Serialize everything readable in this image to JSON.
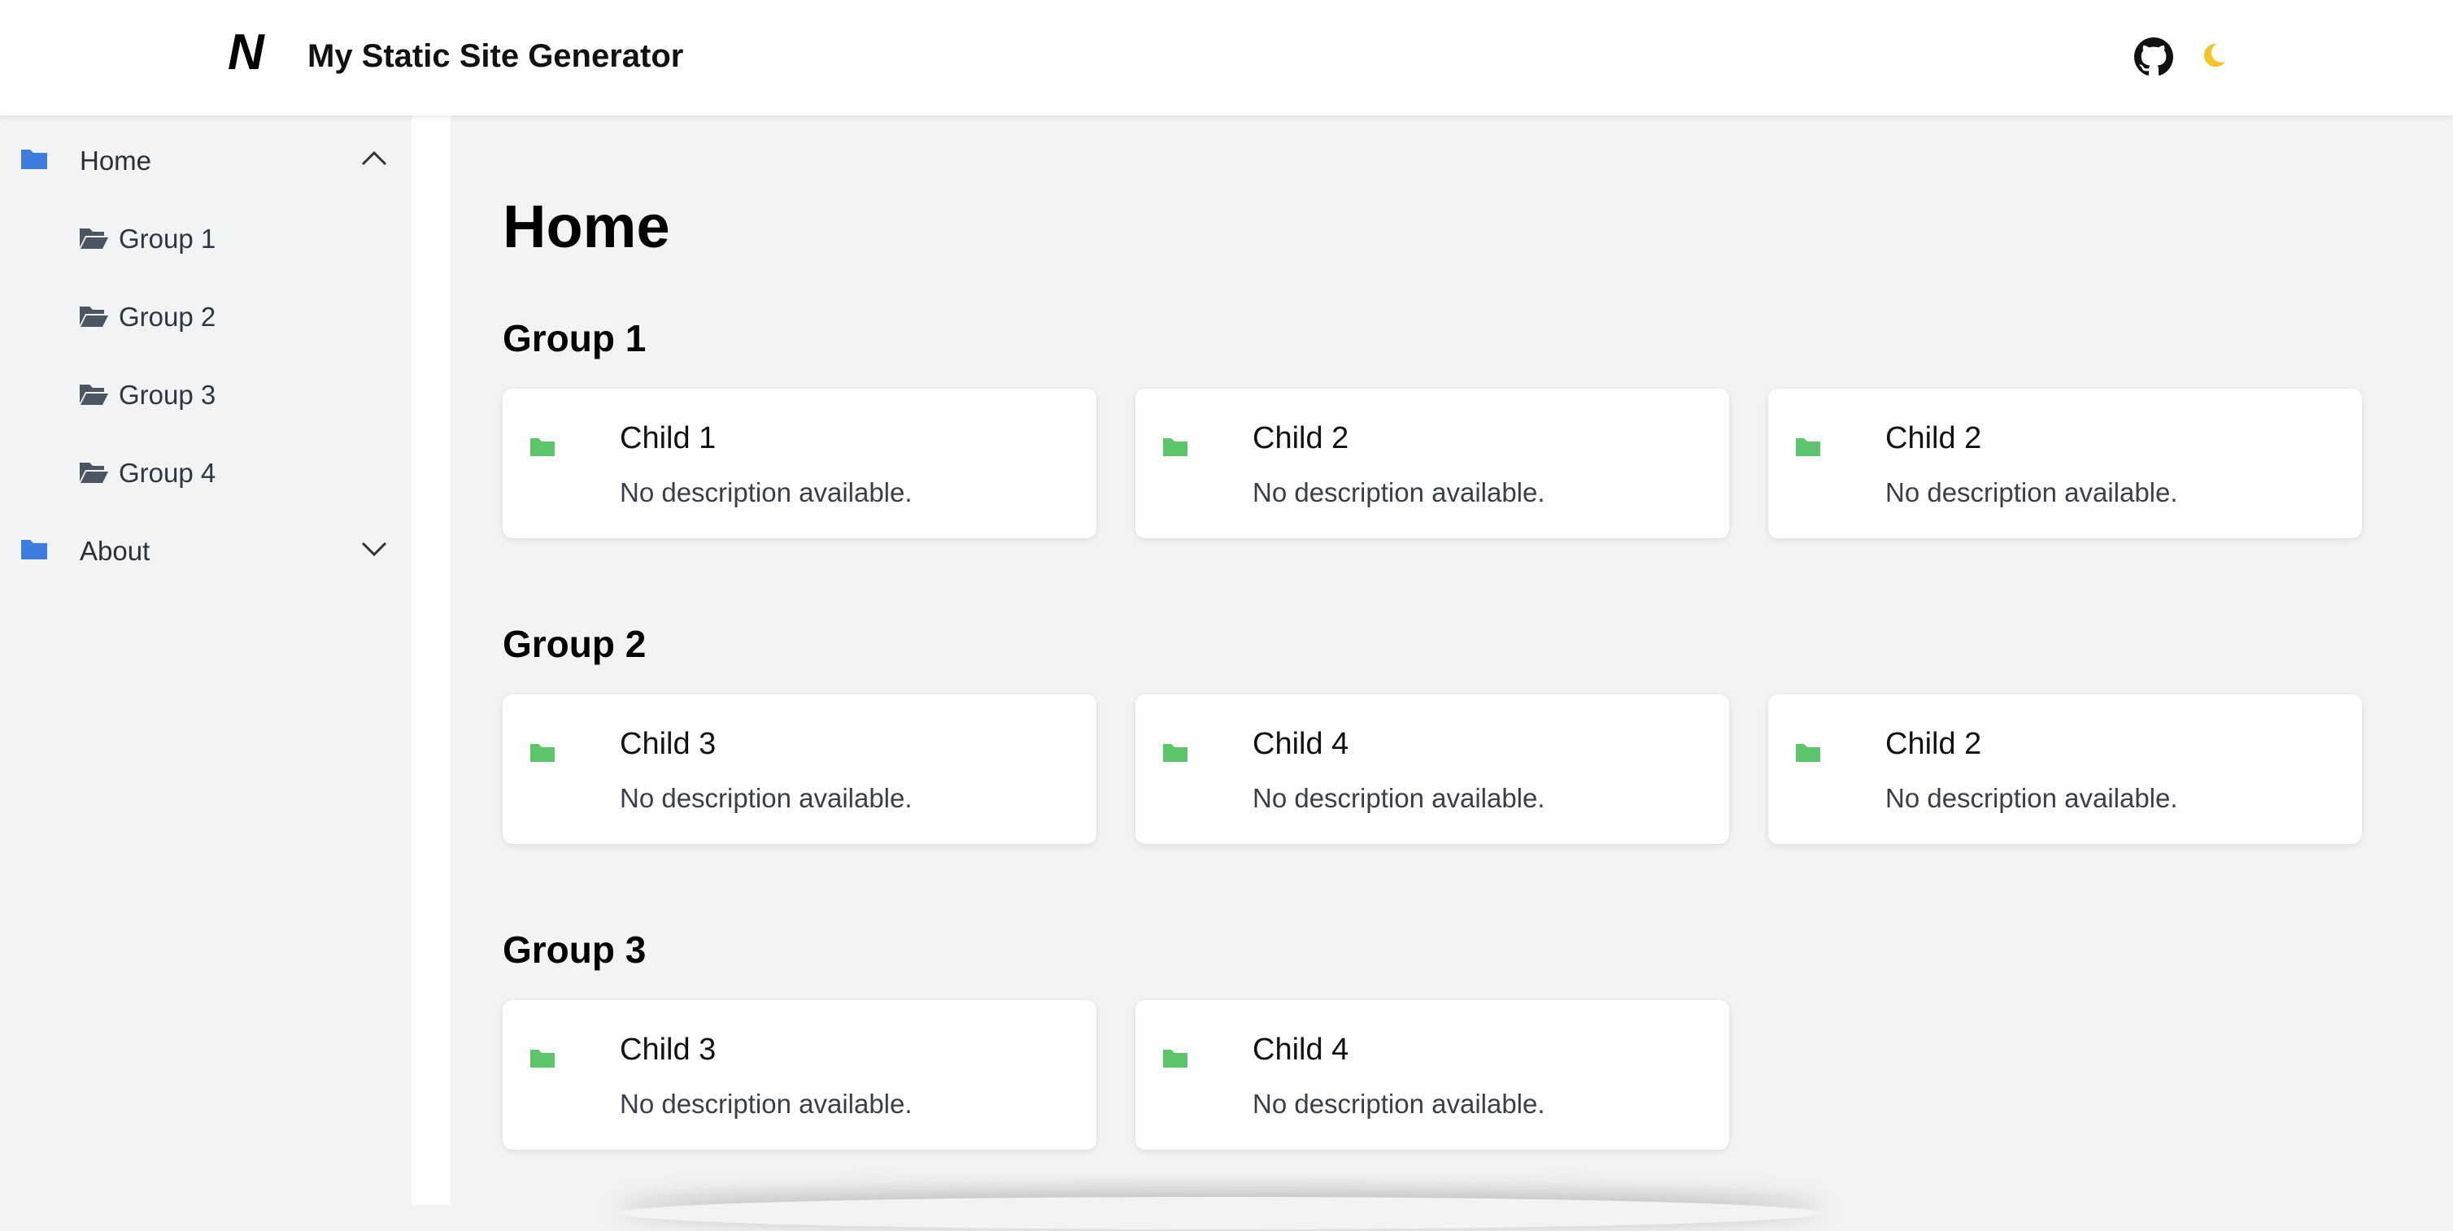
{
  "header": {
    "logo_text": "N",
    "site_title": "My Static Site Generator",
    "github_icon": "github-icon",
    "theme_icon": "moon-icon"
  },
  "sidebar": {
    "items": [
      {
        "label": "Home",
        "icon": "folder-icon",
        "expanded": true
      },
      {
        "label": "Group 1",
        "icon": "folder-open-icon"
      },
      {
        "label": "Group 2",
        "icon": "folder-open-icon"
      },
      {
        "label": "Group 3",
        "icon": "folder-open-icon"
      },
      {
        "label": "Group 4",
        "icon": "folder-open-icon"
      },
      {
        "label": "About",
        "icon": "folder-icon",
        "expanded": false
      }
    ]
  },
  "main": {
    "title": "Home",
    "groups": [
      {
        "title": "Group 1",
        "cards": [
          {
            "title": "Child 1",
            "description": "No description available."
          },
          {
            "title": "Child 2",
            "description": "No description available."
          },
          {
            "title": "Child 2",
            "description": "No description available."
          }
        ]
      },
      {
        "title": "Group 2",
        "cards": [
          {
            "title": "Child 3",
            "description": "No description available."
          },
          {
            "title": "Child 4",
            "description": "No description available."
          },
          {
            "title": "Child 2",
            "description": "No description available."
          }
        ]
      },
      {
        "title": "Group 3",
        "cards": [
          {
            "title": "Child 3",
            "description": "No description available."
          },
          {
            "title": "Child 4",
            "description": "No description available."
          }
        ]
      }
    ]
  },
  "colors": {
    "sidebar_folder": "#3b7ddd",
    "card_folder": "#5cc56b",
    "moon": "#f3c623",
    "background": "#f2f3f5"
  }
}
